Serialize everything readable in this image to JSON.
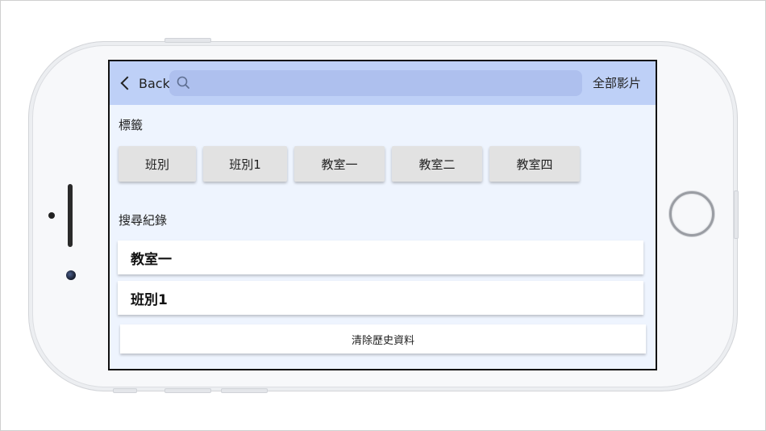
{
  "navbar": {
    "back_label": "Back",
    "search_placeholder": "",
    "search_value": "",
    "right_action_label": "全部影片",
    "background_color": "#bed0f7"
  },
  "tags_section": {
    "title": "標籤",
    "tags": [
      "班別",
      "班別1",
      "教室一",
      "教室二",
      "教室四"
    ]
  },
  "history_section": {
    "title": "搜尋紀錄",
    "items": [
      "教室一",
      "班別1"
    ],
    "clear_label": "清除歷史資料"
  },
  "icons": {
    "back": "chevron-left-icon",
    "search": "search-icon"
  }
}
